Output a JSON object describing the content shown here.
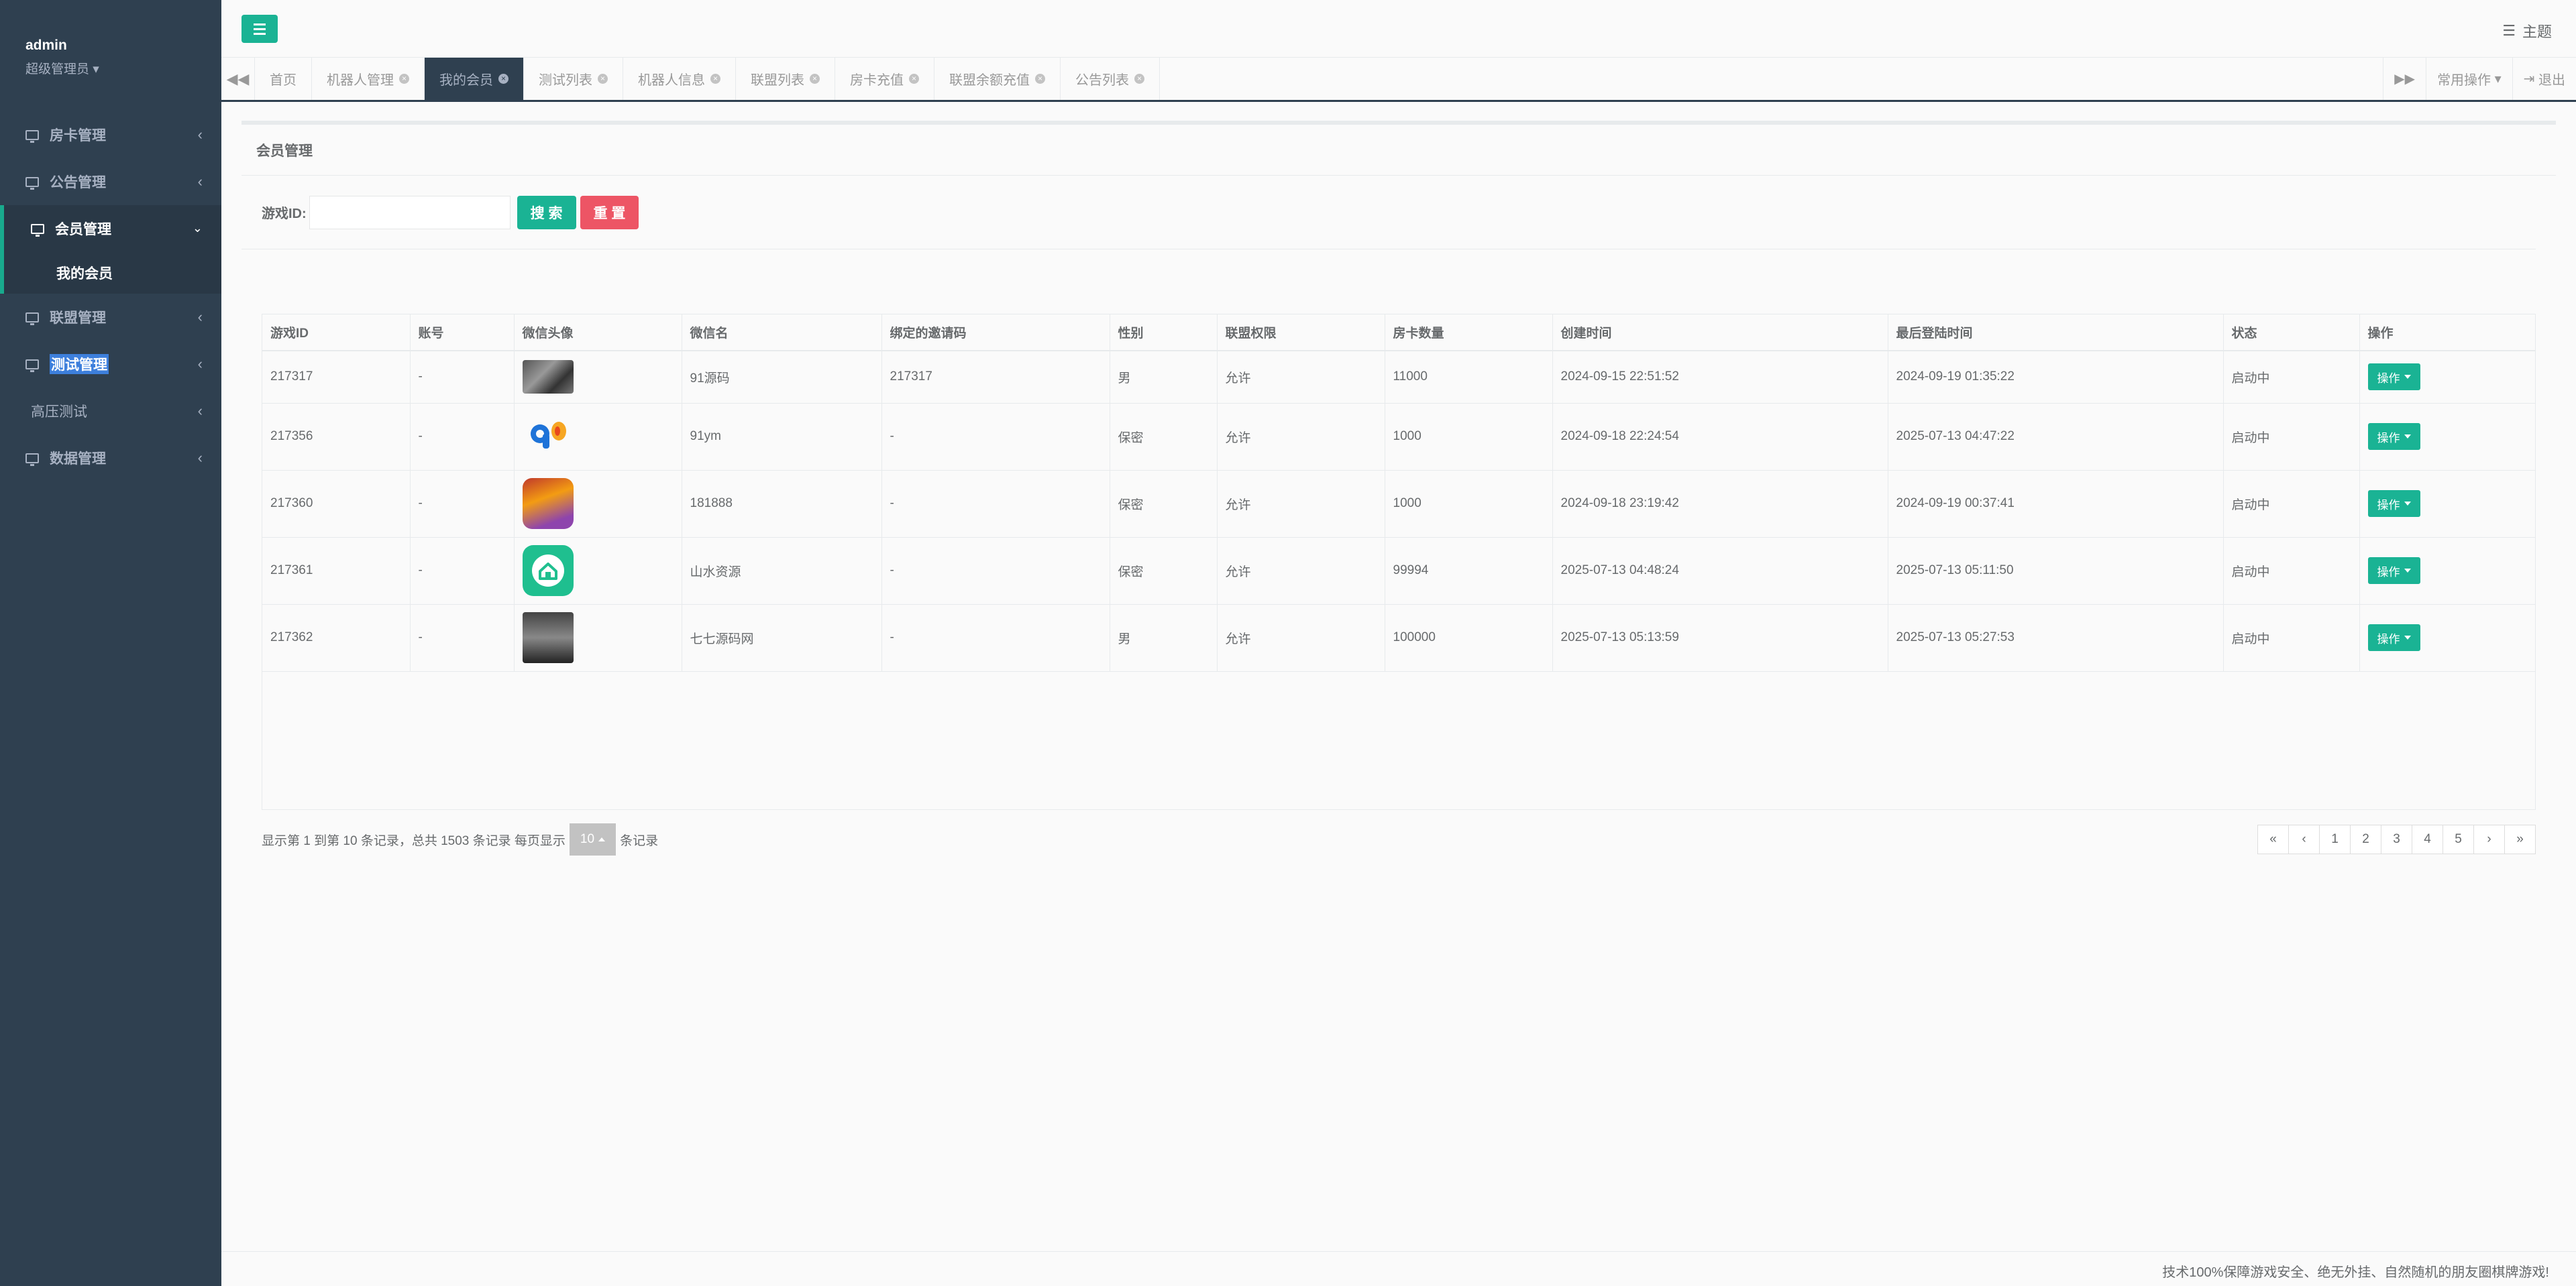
{
  "sidebar": {
    "user": "admin",
    "role": "超级管理员",
    "items": [
      {
        "label": "房卡管理",
        "icon": "monitor-icon",
        "active": false
      },
      {
        "label": "公告管理",
        "icon": "monitor-icon",
        "active": false
      },
      {
        "label": "会员管理",
        "icon": "monitor-icon",
        "active": true
      },
      {
        "label": "联盟管理",
        "icon": "monitor-icon",
        "active": false
      },
      {
        "label": "测试管理",
        "icon": "monitor-icon",
        "active": false
      },
      {
        "label": "高压测试",
        "icon": "",
        "active": false
      },
      {
        "label": "数据管理",
        "icon": "monitor-icon",
        "active": false
      }
    ],
    "subitem": "我的会员"
  },
  "topbar": {
    "theme_label": "主题"
  },
  "tabs": [
    {
      "label": "首页",
      "closable": false,
      "active": false
    },
    {
      "label": "机器人管理",
      "closable": true,
      "active": false
    },
    {
      "label": "我的会员",
      "closable": true,
      "active": true
    },
    {
      "label": "测试列表",
      "closable": true,
      "active": false
    },
    {
      "label": "机器人信息",
      "closable": true,
      "active": false
    },
    {
      "label": "联盟列表",
      "closable": true,
      "active": false
    },
    {
      "label": "房卡充值",
      "closable": true,
      "active": false
    },
    {
      "label": "联盟余额充值",
      "closable": true,
      "active": false
    },
    {
      "label": "公告列表",
      "closable": true,
      "active": false
    }
  ],
  "tabbar_right": {
    "ops_label": "常用操作",
    "logout_label": "退出"
  },
  "panel": {
    "title": "会员管理"
  },
  "search": {
    "label": "游戏ID:",
    "value": "",
    "placeholder": "",
    "search_label": "搜 索",
    "reset_label": "重 置"
  },
  "table": {
    "columns": [
      "游戏ID",
      "账号",
      "微信头像",
      "微信名",
      "绑定的邀请码",
      "性别",
      "联盟权限",
      "房卡数量",
      "创建时间",
      "最后登陆时间",
      "状态",
      "操作"
    ],
    "rows": [
      {
        "id": "217317",
        "account": "-",
        "name": "91源码",
        "invite": "217317",
        "gender": "男",
        "perm": "允许",
        "cards": "11000",
        "created": "2024-09-15 22:51:52",
        "last": "2024-09-19 01:35:22",
        "status": "启动中"
      },
      {
        "id": "217356",
        "account": "-",
        "name": "91ym",
        "invite": "-",
        "gender": "保密",
        "perm": "允许",
        "cards": "1000",
        "created": "2024-09-18 22:24:54",
        "last": "2025-07-13 04:47:22",
        "status": "启动中"
      },
      {
        "id": "217360",
        "account": "-",
        "name": "181888",
        "invite": "-",
        "gender": "保密",
        "perm": "允许",
        "cards": "1000",
        "created": "2024-09-18 23:19:42",
        "last": "2024-09-19 00:37:41",
        "status": "启动中"
      },
      {
        "id": "217361",
        "account": "-",
        "name": "山水资源",
        "invite": "-",
        "gender": "保密",
        "perm": "允许",
        "cards": "99994",
        "created": "2025-07-13 04:48:24",
        "last": "2025-07-13 05:11:50",
        "status": "启动中"
      },
      {
        "id": "217362",
        "account": "-",
        "name": "七七源码网",
        "invite": "-",
        "gender": "男",
        "perm": "允许",
        "cards": "100000",
        "created": "2025-07-13 05:13:59",
        "last": "2025-07-13 05:27:53",
        "status": "启动中"
      }
    ],
    "op_label": "操作"
  },
  "pager": {
    "info_prefix": "显示第 1 到第 10 条记录，总共 1503 条记录 每页显示",
    "page_size": "10",
    "info_suffix": "条记录",
    "pages": [
      "«",
      "‹",
      "1",
      "2",
      "3",
      "4",
      "5",
      "›",
      "»"
    ]
  },
  "footer": {
    "text": "技术100%保障游戏安全、绝无外挂、自然随机的朋友圈棋牌游戏!"
  },
  "colors": {
    "sidebar": "#2f4050",
    "accent": "#1ab394",
    "danger": "#ed5565"
  }
}
